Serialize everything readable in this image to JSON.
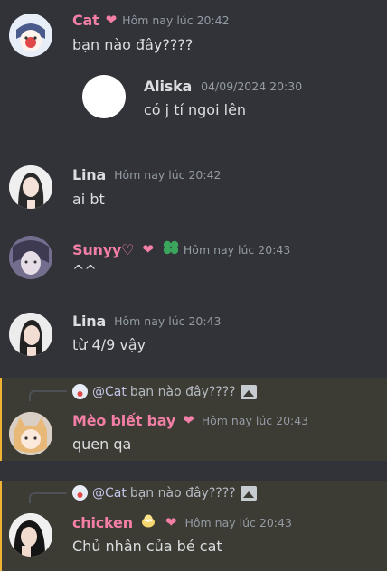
{
  "colors": {
    "background": "#313338",
    "highlight_bg": "#3c3b34",
    "mention": "#c2c4e8",
    "pink_name": "#f47fa6",
    "timestamp": "#949ba4"
  },
  "messages": [
    {
      "author": "Cat",
      "time": "Hôm nay lúc 20:42",
      "text": "bạn nào đây????",
      "name_color": "#f47fa6",
      "badge": "heart-icon"
    },
    {
      "author": "Aliska",
      "time": "04/09/2024 20:30",
      "text": "có j tí ngoi lên"
    },
    {
      "author": "Lina",
      "time": "Hôm nay lúc 20:42",
      "text": "ai bt"
    },
    {
      "author": "Sunyy♡",
      "time": "Hôm nay lúc 20:43",
      "text": "^^",
      "name_color": "#f47fa6",
      "badges": [
        "heart-icon",
        "clover-icon"
      ]
    },
    {
      "author": "Lina",
      "time": "Hôm nay lúc 20:43",
      "text": "từ 4/9 vậy"
    },
    {
      "reply_to": "@Cat",
      "reply_text": "bạn nào đây????",
      "author": "Mèo biết bay",
      "time": "Hôm nay lúc 20:43",
      "text": "quen qa",
      "name_color": "#f47fa6",
      "badge": "heart-icon"
    },
    {
      "reply_to": "@Cat",
      "reply_text": "bạn nào đây????",
      "author": "chicken",
      "time": "Hôm nay lúc 20:43",
      "text": "Chủ nhân của bé cat",
      "name_color": "#f47fa6",
      "badges": [
        "chick-icon",
        "heart-icon"
      ]
    }
  ]
}
